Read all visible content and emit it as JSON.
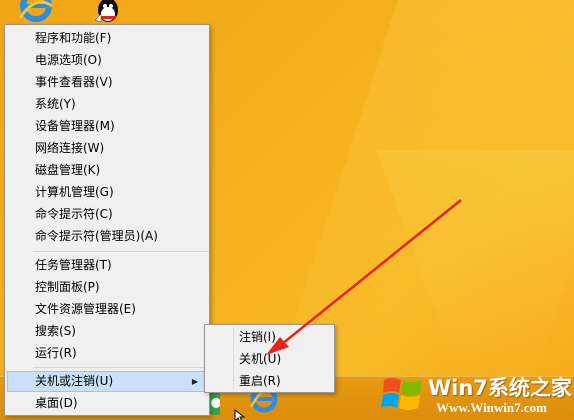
{
  "context_menu": {
    "items": [
      {
        "label": "程序和功能(F)"
      },
      {
        "label": "电源选项(O)"
      },
      {
        "label": "事件查看器(V)"
      },
      {
        "label": "系统(Y)"
      },
      {
        "label": "设备管理器(M)"
      },
      {
        "label": "网络连接(W)"
      },
      {
        "label": "磁盘管理(K)"
      },
      {
        "label": "计算机管理(G)"
      },
      {
        "label": "命令提示符(C)"
      },
      {
        "label": "命令提示符(管理员)(A)"
      },
      {
        "label": "任务管理器(T)"
      },
      {
        "label": "控制面板(P)"
      },
      {
        "label": "文件资源管理器(E)"
      },
      {
        "label": "搜索(S)"
      },
      {
        "label": "运行(R)"
      },
      {
        "label": "关机或注销(U)"
      },
      {
        "label": "桌面(D)"
      }
    ],
    "submenu_arrow": "▶"
  },
  "submenu": {
    "items": [
      {
        "label": "注销(I)"
      },
      {
        "label": "关机(U)"
      },
      {
        "label": "重启(R)"
      }
    ]
  },
  "watermark": {
    "title": "Win7系统之家",
    "url": "Www.Winwin7.com"
  },
  "colors": {
    "desktop": "#f4b01c",
    "menu_bg": "#f0f0f0",
    "highlight": "#c9e0f7",
    "arrow": "#e8231b"
  },
  "icons": [
    "ie-icon",
    "qq-icon",
    "windows-logo-icon",
    "mouse-cursor-icon"
  ]
}
